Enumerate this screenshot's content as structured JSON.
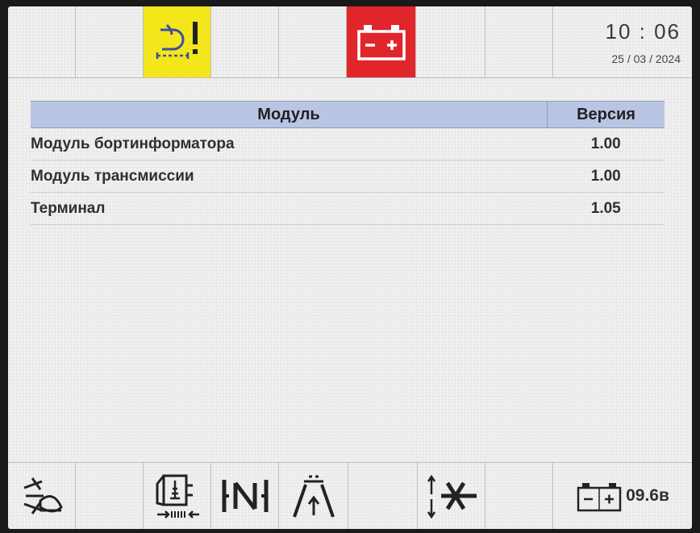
{
  "header": {
    "time": "10 : 06",
    "date": "25 / 03 / 2024",
    "icons": [
      "engine-oil-warning-icon",
      "battery-icon"
    ],
    "colors": {
      "warning": "#f3e61a",
      "alarm": "#e0262a"
    }
  },
  "table": {
    "col_module": "Модуль",
    "col_version": "Версия",
    "rows": [
      {
        "module": "Модуль бортинформатора",
        "version": "1.00"
      },
      {
        "module": "Модуль трансмиссии",
        "version": "1.00"
      },
      {
        "module": "Терминал",
        "version": "1.05"
      }
    ],
    "header_color": "#b9c5e3"
  },
  "footer": {
    "icons": [
      "work-light-icon",
      "engine-speed-icon",
      "neutral-gear-icon",
      "road-mode-icon",
      "hitch-icon",
      "battery-icon"
    ],
    "voltage": "09.6в"
  }
}
